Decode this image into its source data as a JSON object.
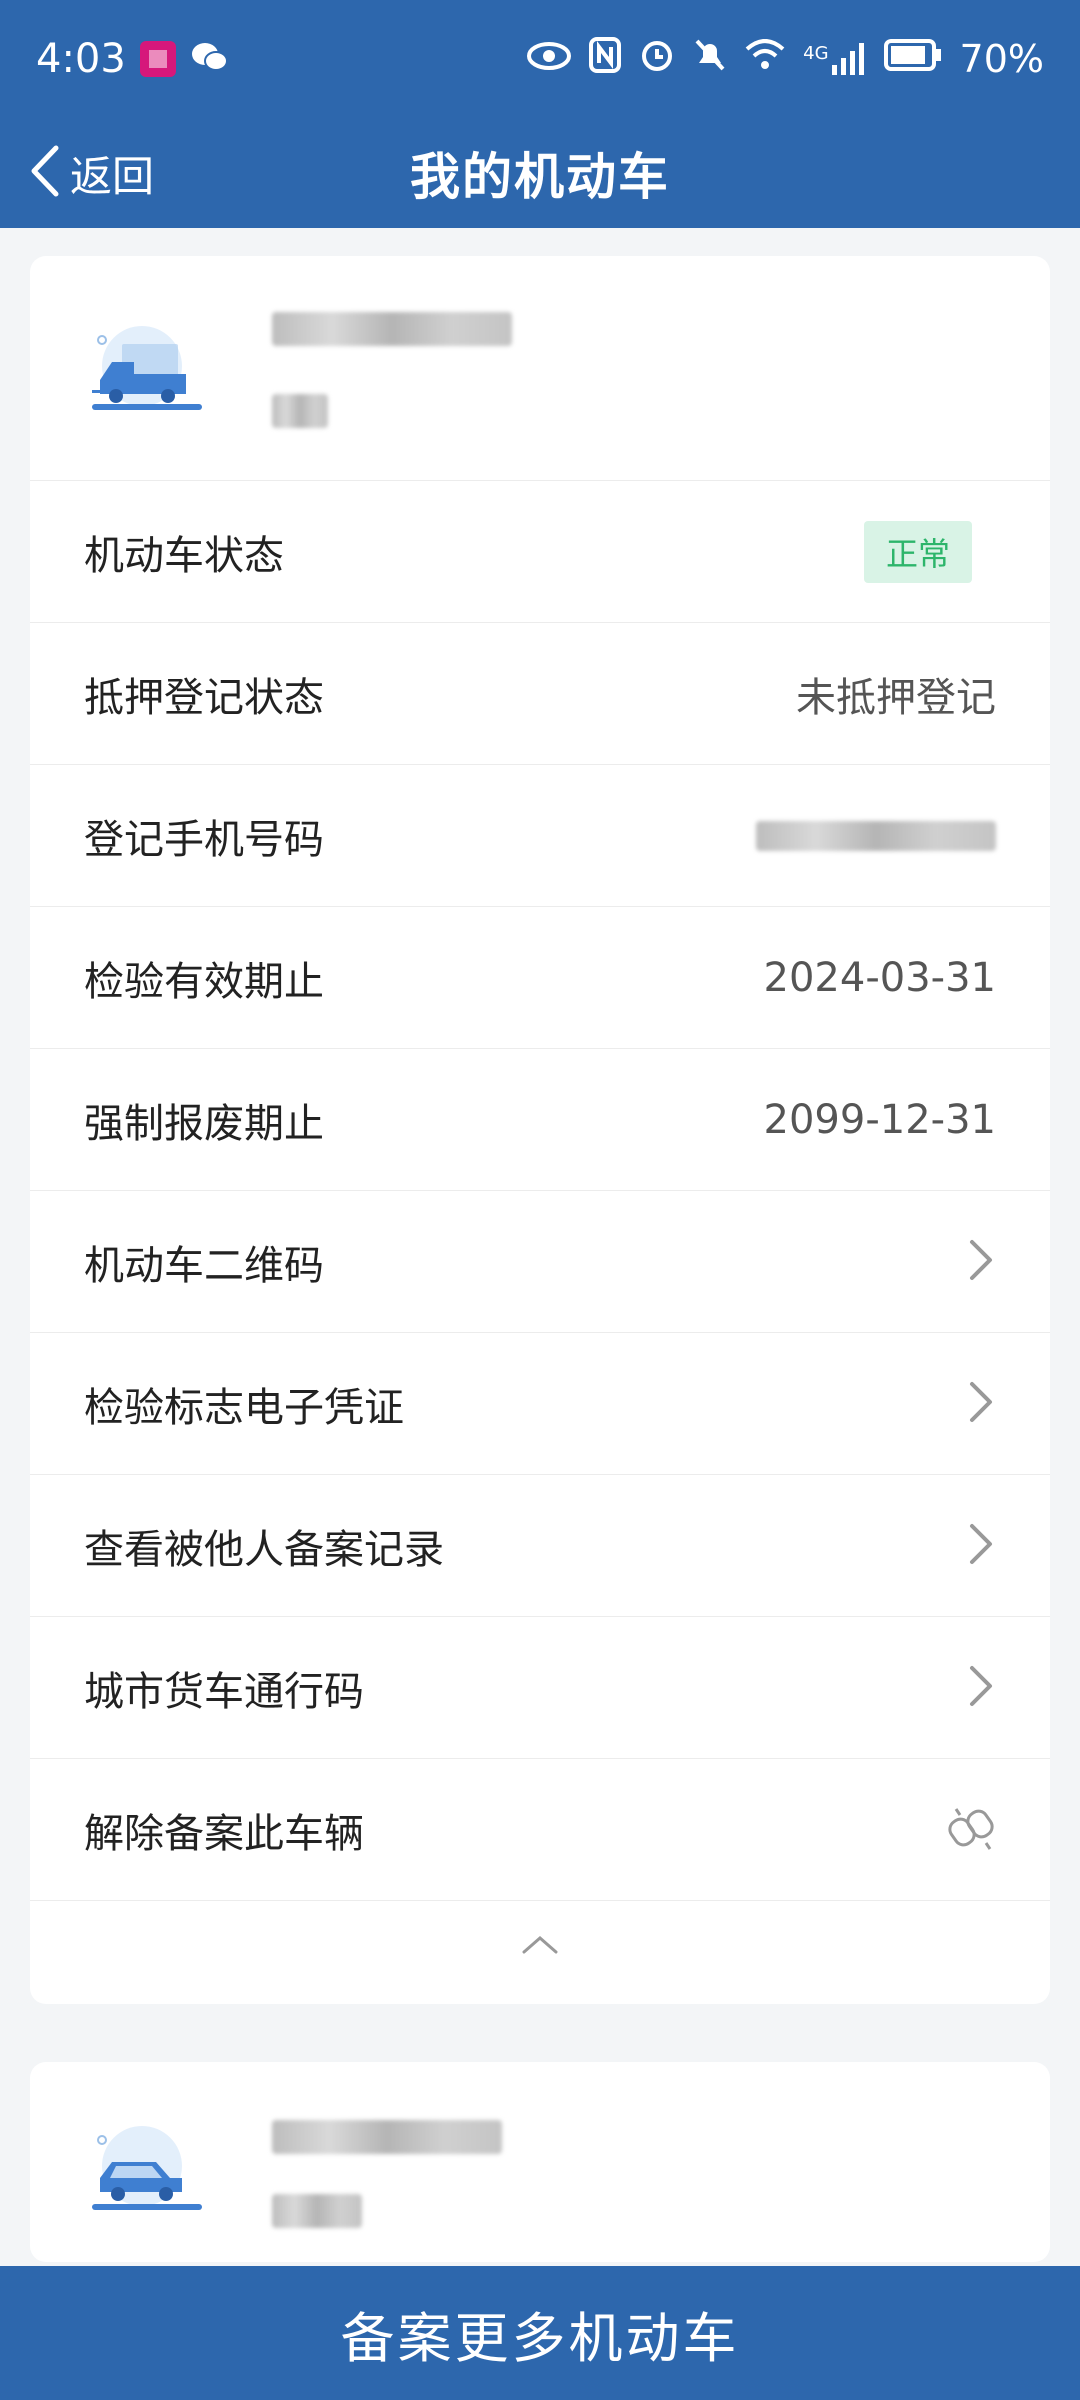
{
  "status_bar": {
    "time": "4:03",
    "network": "4G",
    "battery": "70%"
  },
  "nav": {
    "back_label": "返回",
    "title": "我的机动车"
  },
  "vehicle_card": {
    "rows": [
      {
        "label": "机动车状态",
        "value": "正常",
        "type": "badge"
      },
      {
        "label": "抵押登记状态",
        "value": "未抵押登记",
        "type": "text"
      },
      {
        "label": "登记手机号码",
        "value": "",
        "type": "blurred"
      },
      {
        "label": "检验有效期止",
        "value": "2024-03-31",
        "type": "text"
      },
      {
        "label": "强制报废期止",
        "value": "2099-12-31",
        "type": "text"
      },
      {
        "label": "机动车二维码",
        "type": "link"
      },
      {
        "label": "检验标志电子凭证",
        "type": "link"
      },
      {
        "label": "查看被他人备案记录",
        "type": "link"
      },
      {
        "label": "城市货车通行码",
        "type": "link"
      },
      {
        "label": "解除备案此车辆",
        "type": "unlink"
      }
    ]
  },
  "colors": {
    "brand": "#2d67ad",
    "badge_bg": "#d9f3e6",
    "badge_text": "#2db56b"
  },
  "bottom_button": {
    "label": "备案更多机动车"
  }
}
